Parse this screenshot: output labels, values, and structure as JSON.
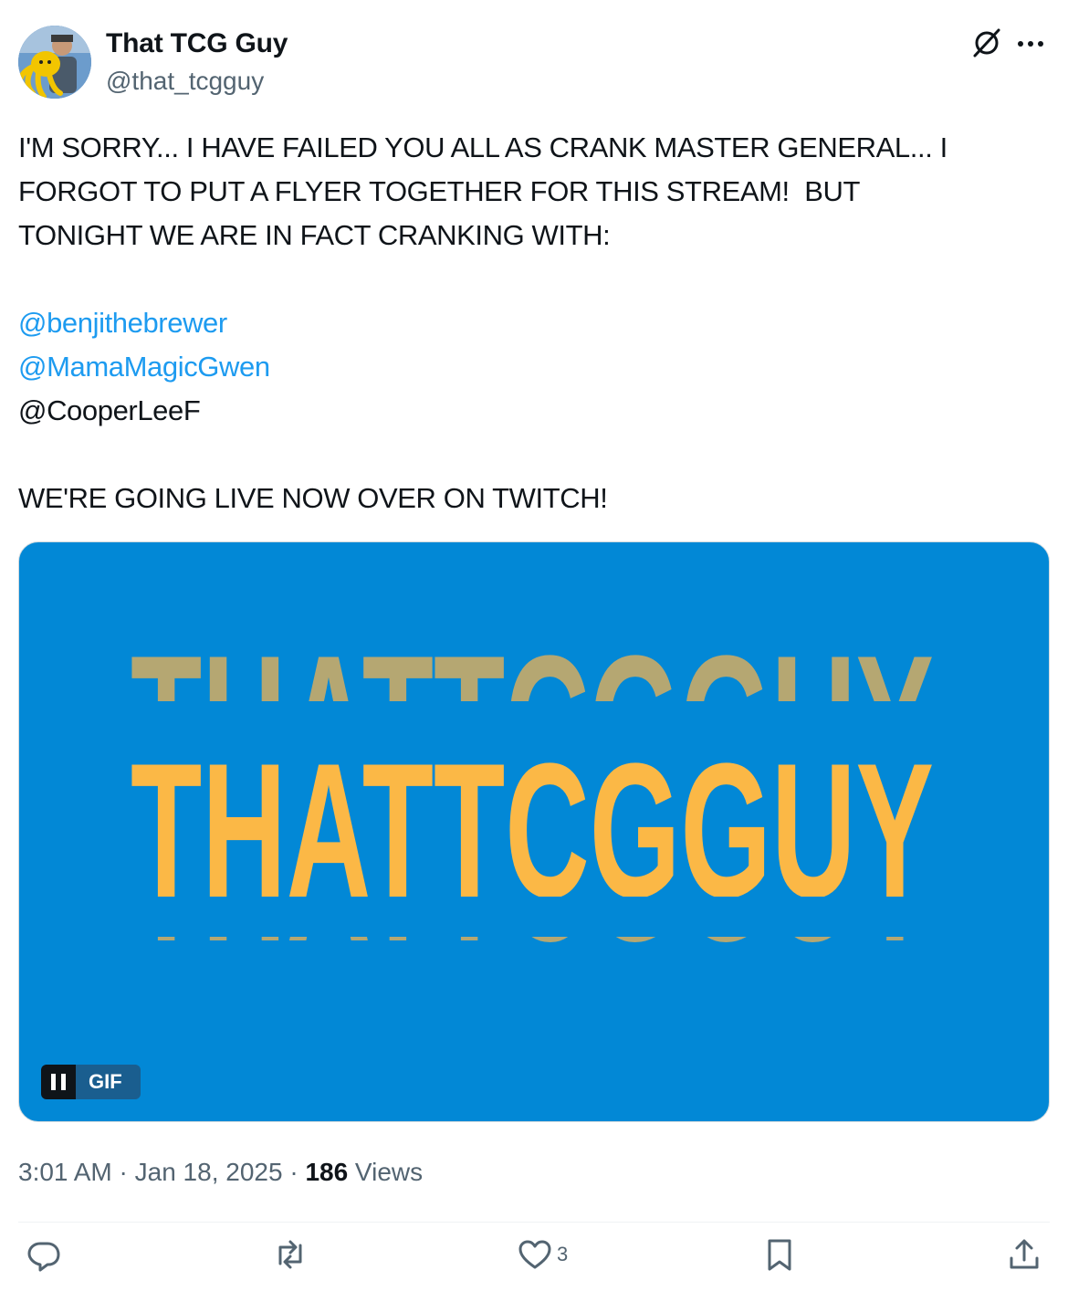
{
  "author": {
    "name": "That TCG Guy",
    "handle": "@that_tcgguy",
    "avatar_icon": "avatar-person-with-octopus-plush"
  },
  "header_icons": [
    "grok-icon",
    "more-icon"
  ],
  "post": {
    "line1": "I'M SORRY... I HAVE FAILED YOU ALL AS CRANK MASTER GENERAL... I",
    "line2": "FORGOT TO PUT A FLYER TOGETHER FOR THIS STREAM!  BUT",
    "line3": "TONIGHT WE ARE IN FACT CRANKING WITH:",
    "mention1": "@benjithebrewer",
    "mention2": "@MamaMagicGwen",
    "mention3": "@CooperLeeF",
    "closing": "WE'RE GOING LIVE NOW OVER ON TWITCH!"
  },
  "media": {
    "wordmark": "THATTCGGUY",
    "badge_label": "GIF",
    "background_color": "#0288d6",
    "highlight_color": "#fbb846"
  },
  "meta": {
    "time": "3:01 AM",
    "sep1": " · ",
    "date": "Jan 18, 2025",
    "sep2": " · ",
    "views_count": "186",
    "views_label": " Views"
  },
  "actions": {
    "reply_icon": "reply-icon",
    "repost_icon": "repost-icon",
    "like_icon": "heart-icon",
    "like_count": "3",
    "bookmark_icon": "bookmark-icon",
    "share_icon": "share-icon"
  },
  "colors": {
    "text": "#0f1419",
    "secondary": "#536471",
    "link": "#1d9bf0"
  }
}
